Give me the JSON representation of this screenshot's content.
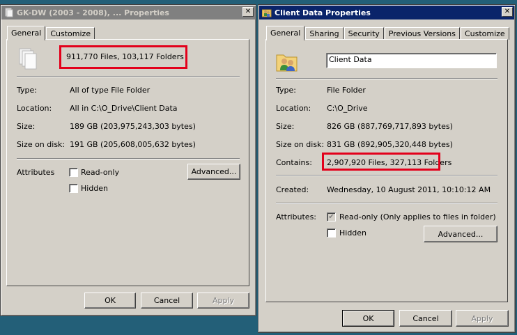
{
  "left_window": {
    "title": "GK-DW (2003 - 2008), ... Properties",
    "close_label": "✕",
    "tabs": [
      "General",
      "Customize"
    ],
    "summary": "911,770 Files, 103,117 Folders",
    "type_label": "Type:",
    "type_value": "All of type File Folder",
    "location_label": "Location:",
    "location_value": "All in C:\\O_Drive\\Client Data",
    "size_label": "Size:",
    "size_value": "189 GB (203,975,243,303 bytes)",
    "size_on_disk_label": "Size on disk:",
    "size_on_disk_value": "191 GB (205,608,005,632 bytes)",
    "attributes_label": "Attributes",
    "readonly_label": "Read-only",
    "hidden_label": "Hidden",
    "advanced_label": "Advanced...",
    "ok_label": "OK",
    "cancel_label": "Cancel",
    "apply_label": "Apply"
  },
  "right_window": {
    "title": "Client Data Properties",
    "close_label": "✕",
    "tabs": [
      "General",
      "Sharing",
      "Security",
      "Previous Versions",
      "Customize"
    ],
    "folder_name": "Client Data",
    "type_label": "Type:",
    "type_value": "File Folder",
    "location_label": "Location:",
    "location_value": "C:\\O_Drive",
    "size_label": "Size:",
    "size_value": "826 GB (887,769,717,893 bytes)",
    "size_on_disk_label": "Size on disk:",
    "size_on_disk_value": "831 GB (892,905,320,448 bytes)",
    "contains_label": "Contains:",
    "contains_value": "2,907,920 Files, 327,113 Folders",
    "created_label": "Created:",
    "created_value": "Wednesday, 10 August 2011, 10:10:12 AM",
    "attributes_label": "Attributes:",
    "readonly_label": "Read-only (Only applies to files in folder)",
    "readonly_check": "✔",
    "hidden_label": "Hidden",
    "advanced_label": "Advanced...",
    "ok_label": "OK",
    "cancel_label": "Cancel",
    "apply_label": "Apply"
  },
  "colors": {
    "highlight_box": "#e3001b",
    "desktop": "#235f78",
    "active_titlebar": "#0a246a",
    "inactive_titlebar": "#808080"
  }
}
